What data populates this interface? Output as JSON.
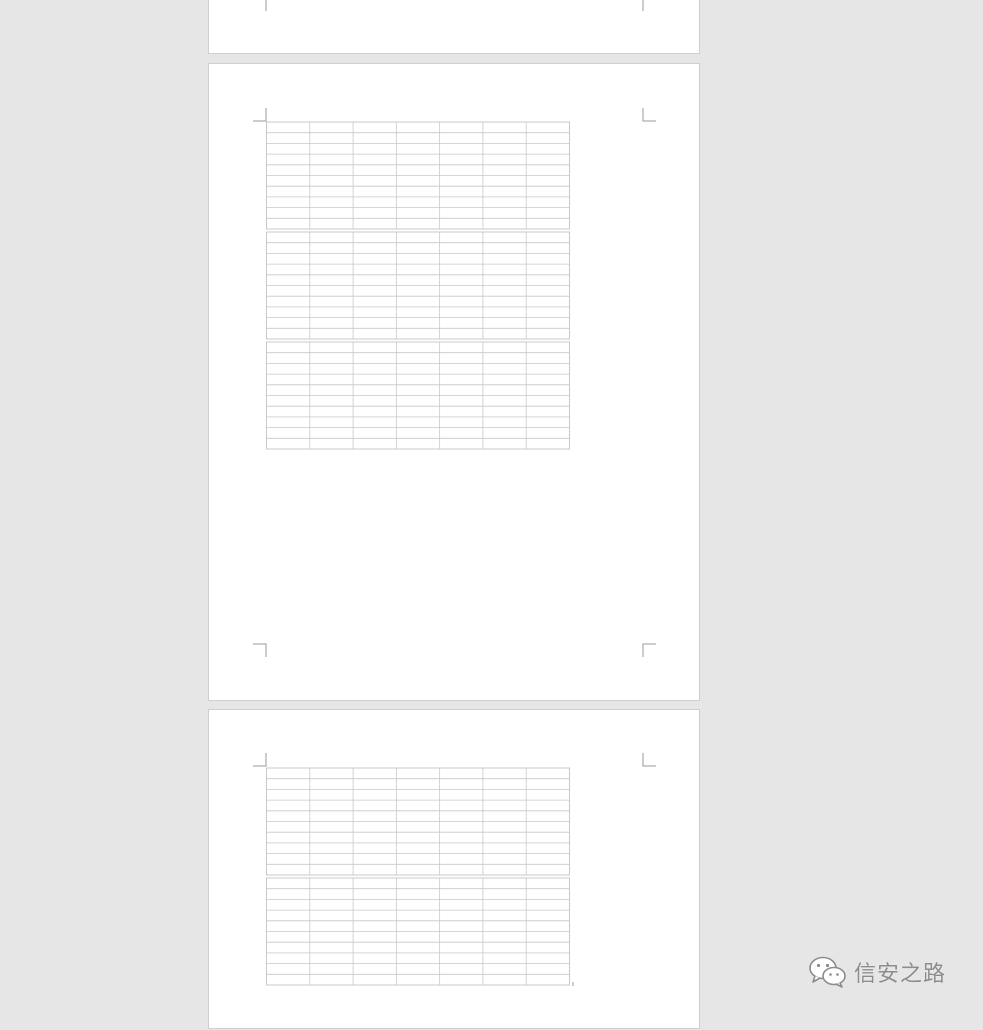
{
  "document": {
    "view": "print-layout",
    "tables": {
      "columns": 7,
      "rows_per_block": 10
    }
  },
  "watermark": {
    "icon": "wechat-icon",
    "text": "信安之路"
  },
  "colors": {
    "workspace": "#e6e6e6",
    "page": "#ffffff",
    "grid_line": "#c8c8c8",
    "corner_mark": "#9a9a9a"
  }
}
